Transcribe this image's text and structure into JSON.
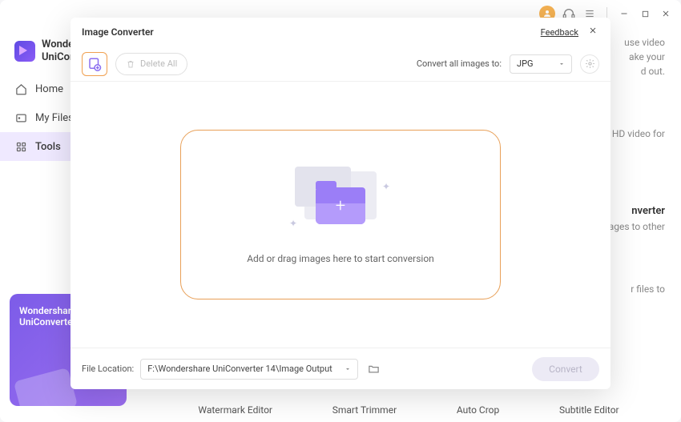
{
  "app": {
    "name_line1": "Wondershare",
    "name_line2": "UniConverter"
  },
  "sidebar": {
    "items": [
      {
        "label": "Home"
      },
      {
        "label": "My Files"
      },
      {
        "label": "Tools"
      }
    ]
  },
  "promo": {
    "line1": "Wondershare",
    "line2": "UniConverter"
  },
  "background": {
    "desc1": "use video",
    "desc2": "ake your",
    "desc3": "d out.",
    "feat1": "HD video for",
    "feat2": "nverter",
    "feat2b": "ages to other",
    "feat3": "r files to",
    "footer": [
      "Watermark Editor",
      "Smart Trimmer",
      "Auto Crop",
      "Subtitle Editor"
    ]
  },
  "modal": {
    "title": "Image Converter",
    "feedback": "Feedback",
    "delete_all": "Delete All",
    "convert_to_label": "Convert all images to:",
    "format": "JPG",
    "dropzone_text": "Add or drag images here to start conversion",
    "file_location_label": "File Location:",
    "file_location_value": "F:\\Wondershare UniConverter 14\\Image Output",
    "convert_btn": "Convert"
  }
}
